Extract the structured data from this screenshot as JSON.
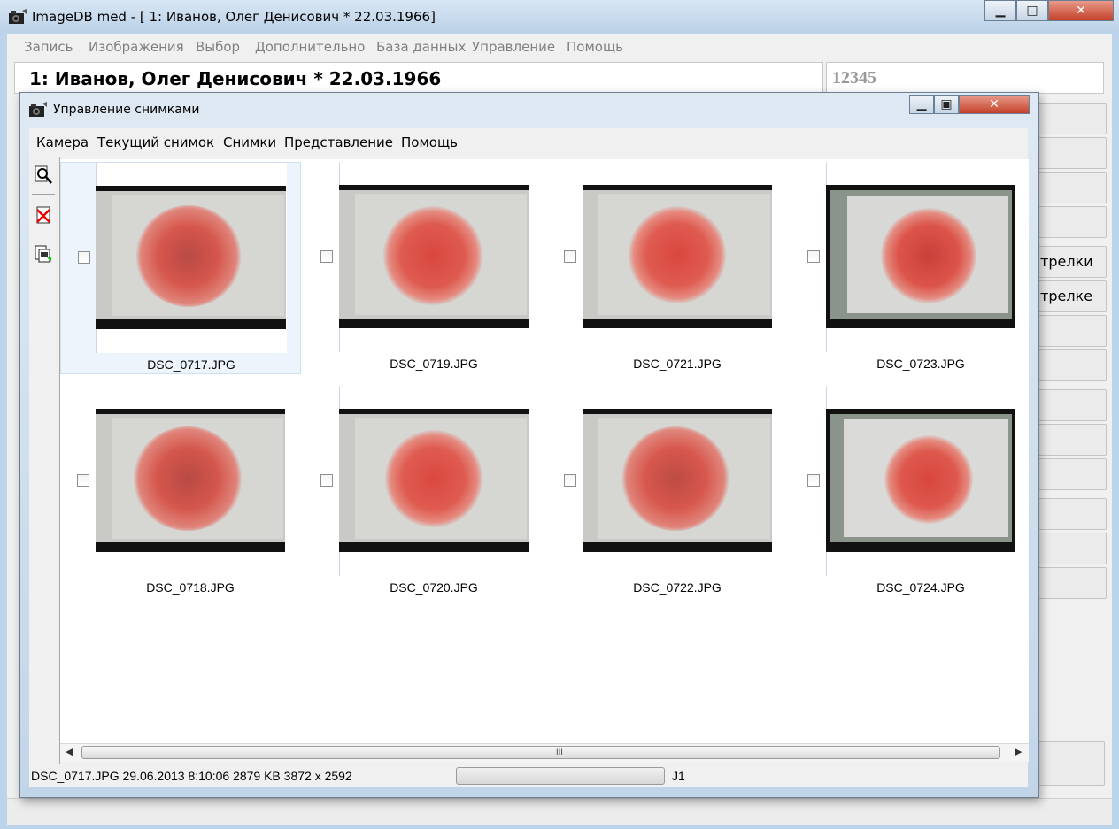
{
  "main_window": {
    "title": "ImageDB med - [  1: Иванов, Олег Денисович   * 22.03.1966]",
    "menu": [
      "Запись",
      "Изображения",
      "Выбор",
      "Дополнительно",
      "База данных",
      "Управление",
      "Помощь"
    ],
    "patient_header": "1: Иванов, Олег Денисович   * 22.03.1966",
    "patient_id": "12345",
    "background_buttons": [
      "трелки",
      "трелке"
    ],
    "caption_buttons": {
      "minimize": "▁",
      "maximize": "□",
      "close": "✕"
    }
  },
  "dialog": {
    "title": "Управление снимками",
    "menu": [
      "Камера",
      "Текущий снимок",
      "Снимки",
      "Представление",
      "Помощь"
    ],
    "toolbar_icons": [
      "zoom-icon",
      "delete-image-icon",
      "export-image-icon"
    ],
    "caption_buttons": {
      "minimize": "▁",
      "maximize": "▣",
      "close": "✕"
    },
    "thumbnails": [
      {
        "label": "DSC_0717.JPG",
        "selected": true,
        "checked": false
      },
      {
        "label": "DSC_0719.JPG",
        "selected": false,
        "checked": false
      },
      {
        "label": "DSC_0721.JPG",
        "selected": false,
        "checked": false
      },
      {
        "label": "DSC_0723.JPG",
        "selected": false,
        "checked": false
      },
      {
        "label": "DSC_0718.JPG",
        "selected": false,
        "checked": false
      },
      {
        "label": "DSC_0720.JPG",
        "selected": false,
        "checked": false
      },
      {
        "label": "DSC_0722.JPG",
        "selected": false,
        "checked": false
      },
      {
        "label": "DSC_0724.JPG",
        "selected": false,
        "checked": false
      }
    ],
    "scrollbar_grip": "III",
    "status": {
      "text": "DSC_0717.JPG 29.06.2013 8:10:06  2879 KB  3872 x 2592",
      "j1": "J1"
    }
  },
  "colors": {
    "title_bar": "#bcd2e8",
    "lesion": "#d9473f",
    "selection": "#eef4fb"
  }
}
